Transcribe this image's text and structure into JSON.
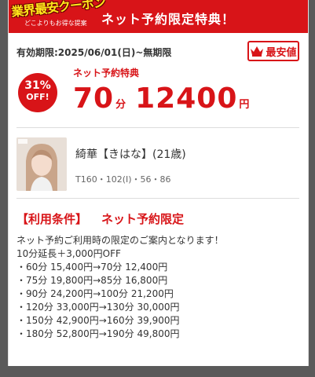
{
  "header": {
    "badge_title": "業界最安クーポン",
    "badge_subtitle": "どこよりもお得な提案",
    "title": "ネット予約限定特典！"
  },
  "coupon": {
    "validity": "有効期限:2025/06/01(日)~無期限",
    "best_badge": "最安値",
    "discount_pct": "31%",
    "discount_off": "OFF!",
    "special_label": "ネット予約特典",
    "minutes": "70",
    "minutes_unit": "分",
    "price": "12400",
    "price_unit": "円"
  },
  "cast": {
    "name": "綺華【きはな】(21歳)",
    "stats": "T160・102(I)・56・86"
  },
  "conditions": {
    "label": "【利用条件】",
    "value": "ネット予約限定",
    "lines": [
      "ネット予約ご利用時の限定のご案内となります！",
      "10分延長＋3,000円OFF",
      "・60分 15,400円→70分 12,400円",
      "・75分 19,800円→85分 16,800円",
      "・90分 24,200円→100分 21,200円",
      "・120分 33,000円→130分 30,000円",
      "・150分 42,900円→160分 39,900円",
      "・180分 52,800円→190分 49,800円"
    ]
  },
  "colors": {
    "accent": "#d81418",
    "badge_yellow": "#ffe81a",
    "background": "#5a5a5a"
  },
  "icons": {
    "crown": "crown-icon"
  }
}
